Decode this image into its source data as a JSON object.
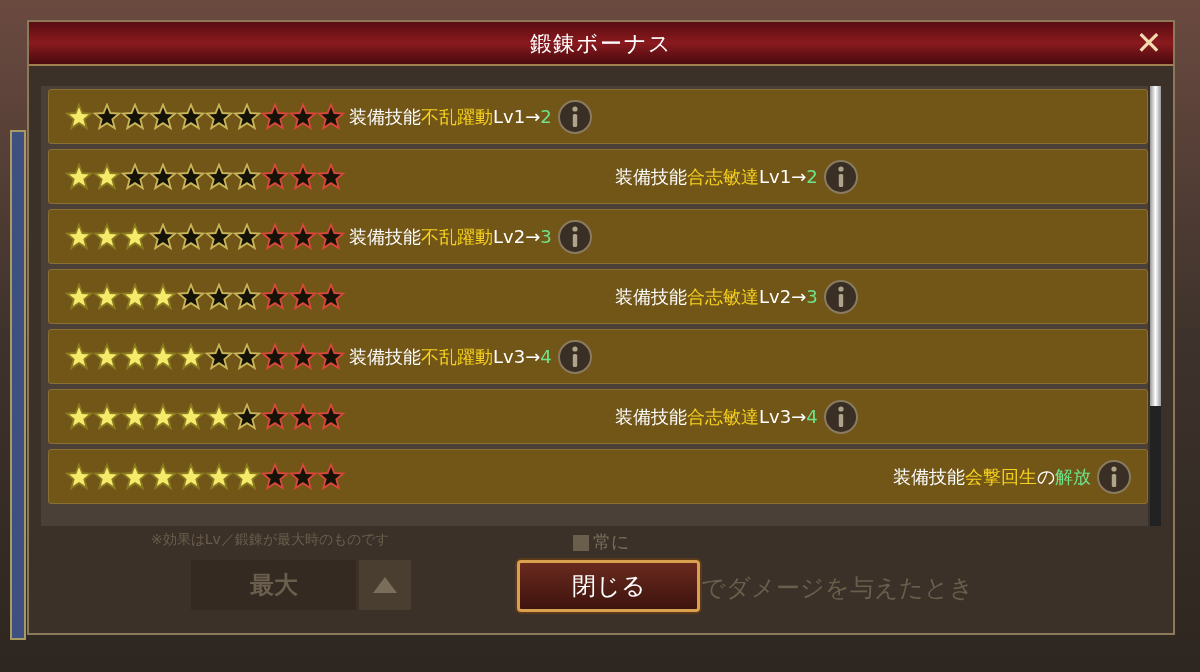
{
  "dialog": {
    "title": "鍛錬ボーナス",
    "close_icon": "✕"
  },
  "rows": [
    {
      "stars": 1,
      "kind": "level-up",
      "text": [
        {
          "kind": "white",
          "text": "装備技能"
        },
        {
          "kind": "yellow",
          "text": "不乱躍動"
        },
        {
          "kind": "white",
          "text": "Lv1→"
        },
        {
          "kind": "green",
          "text": "2"
        }
      ]
    },
    {
      "stars": 2,
      "kind": "level-up",
      "text": [
        {
          "kind": "white",
          "text": "装備技能"
        },
        {
          "kind": "yellow",
          "text": "合志敏達"
        },
        {
          "kind": "white",
          "text": "Lv1→"
        },
        {
          "kind": "green",
          "text": "2"
        }
      ]
    },
    {
      "stars": 3,
      "kind": "level-up",
      "text": [
        {
          "kind": "white",
          "text": "装備技能"
        },
        {
          "kind": "yellow",
          "text": "不乱躍動"
        },
        {
          "kind": "white",
          "text": "Lv2→"
        },
        {
          "kind": "green",
          "text": "3"
        }
      ]
    },
    {
      "stars": 4,
      "kind": "level-up",
      "text": [
        {
          "kind": "white",
          "text": "装備技能"
        },
        {
          "kind": "yellow",
          "text": "合志敏達"
        },
        {
          "kind": "white",
          "text": "Lv2→"
        },
        {
          "kind": "green",
          "text": "3"
        }
      ]
    },
    {
      "stars": 5,
      "kind": "level-up",
      "text": [
        {
          "kind": "white",
          "text": "装備技能"
        },
        {
          "kind": "yellow",
          "text": "不乱躍動"
        },
        {
          "kind": "white",
          "text": "Lv3→"
        },
        {
          "kind": "green",
          "text": "4"
        }
      ]
    },
    {
      "stars": 6,
      "kind": "level-up",
      "text": [
        {
          "kind": "white",
          "text": "装備技能"
        },
        {
          "kind": "yellow",
          "text": "合志敏達"
        },
        {
          "kind": "white",
          "text": "Lv3→"
        },
        {
          "kind": "green",
          "text": "4"
        }
      ]
    },
    {
      "stars": 7,
      "kind": "unlock",
      "text": [
        {
          "kind": "white",
          "text": "装備技能"
        },
        {
          "kind": "yellow",
          "text": "会撃回生"
        },
        {
          "kind": "white",
          "text": "の"
        },
        {
          "kind": "green",
          "text": "解放"
        }
      ]
    }
  ],
  "background": {
    "note": "※効果はLv／鍛錬が最大時のものです",
    "level_value": "最大",
    "condition": "常に",
    "trigger": "でダメージを与えたとき"
  },
  "close_button": "閉じる"
}
